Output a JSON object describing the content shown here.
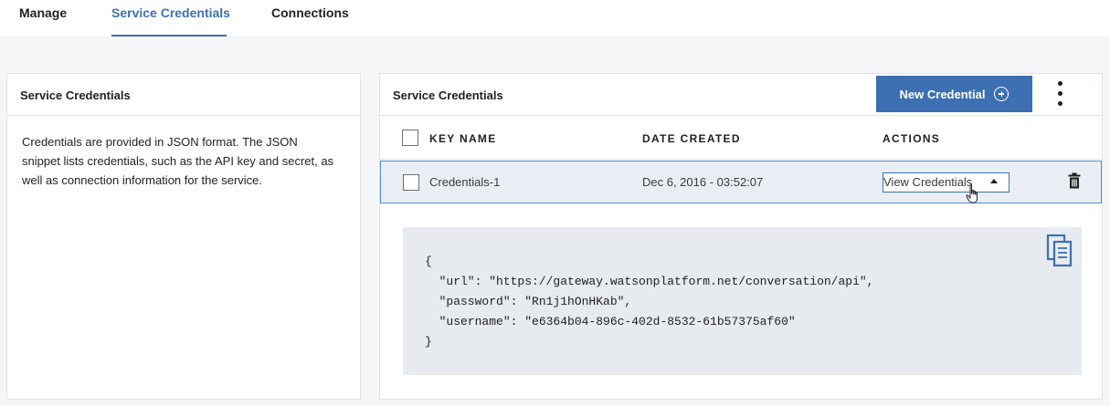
{
  "tabs": [
    {
      "label": "Manage"
    },
    {
      "label": "Service Credentials"
    },
    {
      "label": "Connections"
    }
  ],
  "left_panel": {
    "title": "Service Credentials",
    "description": "Credentials are provided in JSON format. The JSON snippet lists credentials, such as the API key and secret, as well as connection information for the service."
  },
  "right_panel": {
    "title": "Service Credentials",
    "new_button_label": "New Credential",
    "columns": [
      "KEY NAME",
      "DATE CREATED",
      "ACTIONS"
    ],
    "rows": [
      {
        "key_name": "Credentials-1",
        "date_created": "Dec 6, 2016 - 03:52:07",
        "action_label": "View Credentials"
      }
    ],
    "json_text": "{\n  \"url\": \"https://gateway.watsonplatform.net/conversation/api\",\n  \"password\": \"Rn1j1hOnHKab\",\n  \"username\": \"e6364b04-896c-402d-8532-61b57375af60\"\n}"
  },
  "icons": {
    "new_button": "plus-circle-icon",
    "more": "kebab-menu-icon",
    "dropdown": "caret-up-icon",
    "delete": "trash-icon",
    "copy": "copy-icon",
    "cursor": "hand-pointer-icon"
  },
  "colors": {
    "accent": "#3d70b2",
    "page_background": "#f4f6f8",
    "selected_row": "#e9eef5",
    "code_background": "#e7ebf0"
  }
}
